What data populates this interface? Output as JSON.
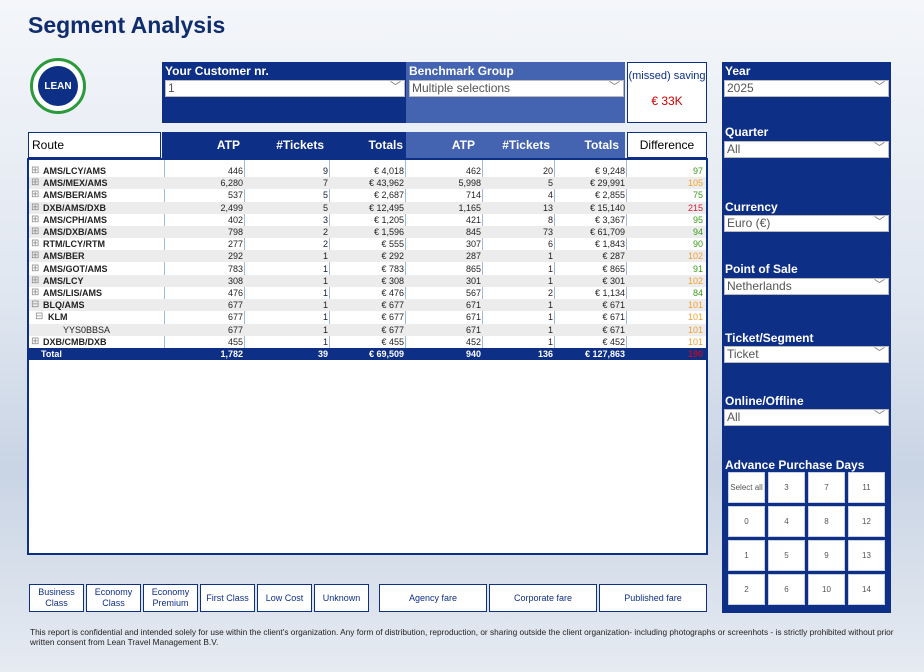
{
  "title": "Segment Analysis",
  "logo_text": "LEAN",
  "customer": {
    "label": "Your Customer nr.",
    "value": "1"
  },
  "benchmark": {
    "label": "Benchmark Group",
    "value": "Multiple selections"
  },
  "saving": {
    "label": "(missed) saving",
    "value": "€ 33K"
  },
  "table": {
    "route_header": "Route",
    "difference_header": "Difference",
    "own_headers": [
      "ATP",
      "#Tickets",
      "Totals"
    ],
    "bench_headers": [
      "ATP",
      "#Tickets",
      "Totals"
    ],
    "rows": [
      {
        "route": "AMS/LCY/AMS",
        "exp": "+",
        "atp": "446",
        "tk": "9",
        "tot": "€ 4,018",
        "batp": "462",
        "btk": "20",
        "btot": "€ 9,248",
        "diff": "97",
        "color": "#3a9a1a"
      },
      {
        "route": "AMS/MEX/AMS",
        "exp": "+",
        "atp": "6,280",
        "tk": "7",
        "tot": "€ 43,962",
        "batp": "5,998",
        "btk": "5",
        "btot": "€ 29,991",
        "diff": "105",
        "color": "#f0a030"
      },
      {
        "route": "AMS/BER/AMS",
        "exp": "+",
        "atp": "537",
        "tk": "5",
        "tot": "€ 2,687",
        "batp": "714",
        "btk": "4",
        "btot": "€ 2,855",
        "diff": "75",
        "color": "#3a9a1a"
      },
      {
        "route": "DXB/AMS/DXB",
        "exp": "+",
        "atp": "2,499",
        "tk": "5",
        "tot": "€ 12,495",
        "batp": "1,165",
        "btk": "13",
        "btot": "€ 15,140",
        "diff": "215",
        "color": "#d0203a"
      },
      {
        "route": "AMS/CPH/AMS",
        "exp": "+",
        "atp": "402",
        "tk": "3",
        "tot": "€ 1,205",
        "batp": "421",
        "btk": "8",
        "btot": "€ 3,367",
        "diff": "95",
        "color": "#3a9a1a"
      },
      {
        "route": "AMS/DXB/AMS",
        "exp": "+",
        "atp": "798",
        "tk": "2",
        "tot": "€ 1,596",
        "batp": "845",
        "btk": "73",
        "btot": "€ 61,709",
        "diff": "94",
        "color": "#3a9a1a"
      },
      {
        "route": "RTM/LCY/RTM",
        "exp": "+",
        "atp": "277",
        "tk": "2",
        "tot": "€ 555",
        "batp": "307",
        "btk": "6",
        "btot": "€ 1,843",
        "diff": "90",
        "color": "#3a9a1a"
      },
      {
        "route": "AMS/BER",
        "exp": "+",
        "atp": "292",
        "tk": "1",
        "tot": "€ 292",
        "batp": "287",
        "btk": "1",
        "btot": "€ 287",
        "diff": "102",
        "color": "#f0a030"
      },
      {
        "route": "AMS/GOT/AMS",
        "exp": "+",
        "atp": "783",
        "tk": "1",
        "tot": "€ 783",
        "batp": "865",
        "btk": "1",
        "btot": "€ 865",
        "diff": "91",
        "color": "#3a9a1a"
      },
      {
        "route": "AMS/LCY",
        "exp": "+",
        "atp": "308",
        "tk": "1",
        "tot": "€ 308",
        "batp": "301",
        "btk": "1",
        "btot": "€ 301",
        "diff": "102",
        "color": "#f0a030"
      },
      {
        "route": "AMS/LIS/AMS",
        "exp": "+",
        "atp": "476",
        "tk": "1",
        "tot": "€ 476",
        "batp": "567",
        "btk": "2",
        "btot": "€ 1,134",
        "diff": "84",
        "color": "#3a9a1a"
      },
      {
        "route": "BLQ/AMS",
        "exp": "−",
        "atp": "677",
        "tk": "1",
        "tot": "€ 677",
        "batp": "671",
        "btk": "1",
        "btot": "€ 671",
        "diff": "101",
        "color": "#f0a030"
      },
      {
        "route": "KLM",
        "exp": "−",
        "level": 1,
        "atp": "677",
        "tk": "1",
        "tot": "€ 677",
        "batp": "671",
        "btk": "1",
        "btot": "€ 671",
        "diff": "101",
        "color": "#f0a030"
      },
      {
        "route": "YYS0BBSA",
        "exp": "",
        "level": 2,
        "atp": "677",
        "tk": "1",
        "tot": "€ 677",
        "batp": "671",
        "btk": "1",
        "btot": "€ 671",
        "diff": "101",
        "color": "#f0a030"
      },
      {
        "route": "DXB/CMB/DXB",
        "exp": "+",
        "atp": "455",
        "tk": "1",
        "tot": "€ 455",
        "batp": "452",
        "btk": "1",
        "btot": "€ 452",
        "diff": "101",
        "color": "#f0a030"
      }
    ],
    "total": {
      "route": "Total",
      "atp": "1,782",
      "tk": "39",
      "tot": "€ 69,509",
      "batp": "940",
      "btk": "136",
      "btot": "€ 127,863",
      "diff": "190",
      "color": "#b0102a"
    }
  },
  "slicers": [
    {
      "label": "Year",
      "value": "2025"
    },
    {
      "label": "Quarter",
      "value": "All"
    },
    {
      "label": "Currency",
      "value": "Euro (€)"
    },
    {
      "label": "Point of Sale",
      "value": "Netherlands"
    },
    {
      "label": "Ticket/Segment",
      "value": "Ticket"
    },
    {
      "label": "Online/Offline",
      "value": "All"
    }
  ],
  "advance_purchase": {
    "label": "Advance Purchase Days",
    "options": [
      "Select all",
      "3",
      "7",
      "11",
      "0",
      "4",
      "8",
      "12",
      "1",
      "5",
      "9",
      "13",
      "2",
      "6",
      "10",
      "14"
    ]
  },
  "class_buttons": [
    "Business Class",
    "Economy Class",
    "Economy Premium",
    "First Class",
    "Low Cost",
    "Unknown"
  ],
  "fare_buttons": [
    "Agency fare",
    "Corporate fare",
    "Published fare"
  ],
  "footer": "This report is confidential and intended solely for use within the client's organization. Any form of distribution, reproduction, or sharing outside the client organization- including photographs or screenhots - is strictly prohibited without prior written consent from Lean Travel Management B.V."
}
